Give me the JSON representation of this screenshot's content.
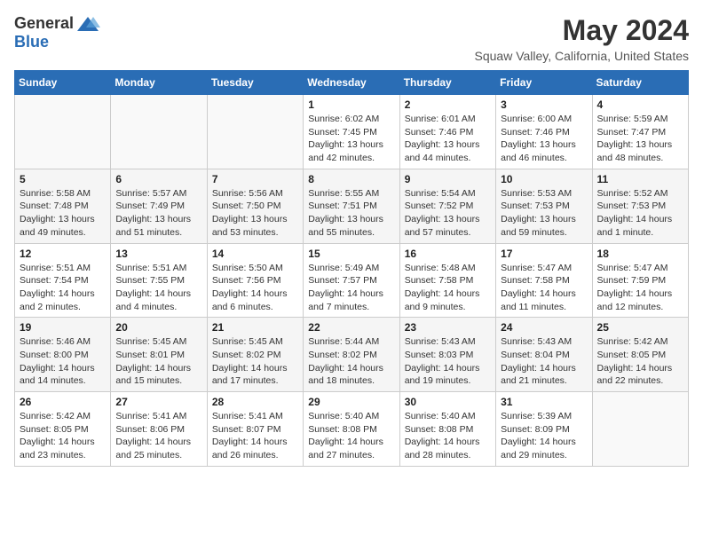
{
  "header": {
    "logo_general": "General",
    "logo_blue": "Blue",
    "month_year": "May 2024",
    "location": "Squaw Valley, California, United States"
  },
  "weekdays": [
    "Sunday",
    "Monday",
    "Tuesday",
    "Wednesday",
    "Thursday",
    "Friday",
    "Saturday"
  ],
  "weeks": [
    [
      {
        "day": "",
        "info": ""
      },
      {
        "day": "",
        "info": ""
      },
      {
        "day": "",
        "info": ""
      },
      {
        "day": "1",
        "info": "Sunrise: 6:02 AM\nSunset: 7:45 PM\nDaylight: 13 hours\nand 42 minutes."
      },
      {
        "day": "2",
        "info": "Sunrise: 6:01 AM\nSunset: 7:46 PM\nDaylight: 13 hours\nand 44 minutes."
      },
      {
        "day": "3",
        "info": "Sunrise: 6:00 AM\nSunset: 7:46 PM\nDaylight: 13 hours\nand 46 minutes."
      },
      {
        "day": "4",
        "info": "Sunrise: 5:59 AM\nSunset: 7:47 PM\nDaylight: 13 hours\nand 48 minutes."
      }
    ],
    [
      {
        "day": "5",
        "info": "Sunrise: 5:58 AM\nSunset: 7:48 PM\nDaylight: 13 hours\nand 49 minutes."
      },
      {
        "day": "6",
        "info": "Sunrise: 5:57 AM\nSunset: 7:49 PM\nDaylight: 13 hours\nand 51 minutes."
      },
      {
        "day": "7",
        "info": "Sunrise: 5:56 AM\nSunset: 7:50 PM\nDaylight: 13 hours\nand 53 minutes."
      },
      {
        "day": "8",
        "info": "Sunrise: 5:55 AM\nSunset: 7:51 PM\nDaylight: 13 hours\nand 55 minutes."
      },
      {
        "day": "9",
        "info": "Sunrise: 5:54 AM\nSunset: 7:52 PM\nDaylight: 13 hours\nand 57 minutes."
      },
      {
        "day": "10",
        "info": "Sunrise: 5:53 AM\nSunset: 7:53 PM\nDaylight: 13 hours\nand 59 minutes."
      },
      {
        "day": "11",
        "info": "Sunrise: 5:52 AM\nSunset: 7:53 PM\nDaylight: 14 hours\nand 1 minute."
      }
    ],
    [
      {
        "day": "12",
        "info": "Sunrise: 5:51 AM\nSunset: 7:54 PM\nDaylight: 14 hours\nand 2 minutes."
      },
      {
        "day": "13",
        "info": "Sunrise: 5:51 AM\nSunset: 7:55 PM\nDaylight: 14 hours\nand 4 minutes."
      },
      {
        "day": "14",
        "info": "Sunrise: 5:50 AM\nSunset: 7:56 PM\nDaylight: 14 hours\nand 6 minutes."
      },
      {
        "day": "15",
        "info": "Sunrise: 5:49 AM\nSunset: 7:57 PM\nDaylight: 14 hours\nand 7 minutes."
      },
      {
        "day": "16",
        "info": "Sunrise: 5:48 AM\nSunset: 7:58 PM\nDaylight: 14 hours\nand 9 minutes."
      },
      {
        "day": "17",
        "info": "Sunrise: 5:47 AM\nSunset: 7:58 PM\nDaylight: 14 hours\nand 11 minutes."
      },
      {
        "day": "18",
        "info": "Sunrise: 5:47 AM\nSunset: 7:59 PM\nDaylight: 14 hours\nand 12 minutes."
      }
    ],
    [
      {
        "day": "19",
        "info": "Sunrise: 5:46 AM\nSunset: 8:00 PM\nDaylight: 14 hours\nand 14 minutes."
      },
      {
        "day": "20",
        "info": "Sunrise: 5:45 AM\nSunset: 8:01 PM\nDaylight: 14 hours\nand 15 minutes."
      },
      {
        "day": "21",
        "info": "Sunrise: 5:45 AM\nSunset: 8:02 PM\nDaylight: 14 hours\nand 17 minutes."
      },
      {
        "day": "22",
        "info": "Sunrise: 5:44 AM\nSunset: 8:02 PM\nDaylight: 14 hours\nand 18 minutes."
      },
      {
        "day": "23",
        "info": "Sunrise: 5:43 AM\nSunset: 8:03 PM\nDaylight: 14 hours\nand 19 minutes."
      },
      {
        "day": "24",
        "info": "Sunrise: 5:43 AM\nSunset: 8:04 PM\nDaylight: 14 hours\nand 21 minutes."
      },
      {
        "day": "25",
        "info": "Sunrise: 5:42 AM\nSunset: 8:05 PM\nDaylight: 14 hours\nand 22 minutes."
      }
    ],
    [
      {
        "day": "26",
        "info": "Sunrise: 5:42 AM\nSunset: 8:05 PM\nDaylight: 14 hours\nand 23 minutes."
      },
      {
        "day": "27",
        "info": "Sunrise: 5:41 AM\nSunset: 8:06 PM\nDaylight: 14 hours\nand 25 minutes."
      },
      {
        "day": "28",
        "info": "Sunrise: 5:41 AM\nSunset: 8:07 PM\nDaylight: 14 hours\nand 26 minutes."
      },
      {
        "day": "29",
        "info": "Sunrise: 5:40 AM\nSunset: 8:08 PM\nDaylight: 14 hours\nand 27 minutes."
      },
      {
        "day": "30",
        "info": "Sunrise: 5:40 AM\nSunset: 8:08 PM\nDaylight: 14 hours\nand 28 minutes."
      },
      {
        "day": "31",
        "info": "Sunrise: 5:39 AM\nSunset: 8:09 PM\nDaylight: 14 hours\nand 29 minutes."
      },
      {
        "day": "",
        "info": ""
      }
    ]
  ]
}
